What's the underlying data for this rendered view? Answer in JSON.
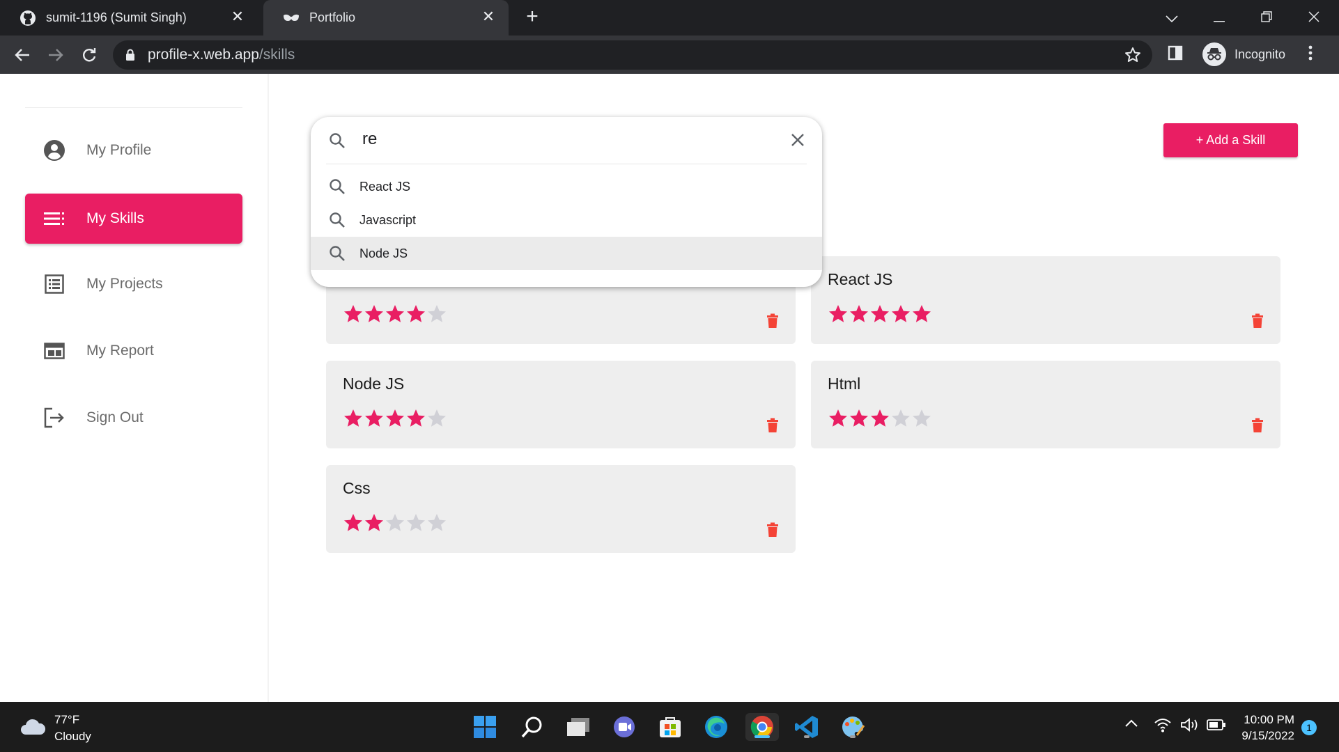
{
  "browser": {
    "tabs": [
      {
        "title": "sumit-1196 (Sumit Singh)",
        "icon": "github-icon",
        "active": false
      },
      {
        "title": "Portfolio",
        "icon": "mask-icon",
        "active": true
      }
    ],
    "url_host": "profile-x.web.app",
    "url_path": "/skills",
    "profile_label": "Incognito",
    "close_glyph": "✕",
    "newtab_glyph": "+"
  },
  "sidebar": {
    "items": [
      {
        "label": "My Profile",
        "icon": "account-circle-icon",
        "active": false
      },
      {
        "label": "My Skills",
        "icon": "list-icon",
        "active": true
      },
      {
        "label": "My Projects",
        "icon": "project-list-icon",
        "active": false
      },
      {
        "label": "My Report",
        "icon": "report-icon",
        "active": false
      },
      {
        "label": "Sign Out",
        "icon": "sign-out-icon",
        "active": false
      }
    ]
  },
  "search": {
    "value": "re",
    "suggestions": [
      {
        "label": "React JS"
      },
      {
        "label": "Javascript"
      },
      {
        "label": "Node JS",
        "selected": true
      }
    ]
  },
  "add_button_label": "+ Add a Skill",
  "skills": [
    {
      "name": "",
      "rating": 4,
      "max": 5
    },
    {
      "name": "React JS",
      "rating": 5,
      "max": 5
    },
    {
      "name": "Node JS",
      "rating": 4,
      "max": 5
    },
    {
      "name": "Html",
      "rating": 3,
      "max": 5
    },
    {
      "name": "Css",
      "rating": 2,
      "max": 5
    }
  ],
  "colors": {
    "accent": "#e91e63",
    "star_filled": "#e91e63",
    "star_empty": "#d0d0d6",
    "trash": "#f44336"
  },
  "taskbar": {
    "weather_temp": "77°F",
    "weather_desc": "Cloudy",
    "apps": [
      "start-icon",
      "search-icon",
      "task-view-icon",
      "chat-icon",
      "store-icon",
      "edge-icon",
      "chrome-icon",
      "vscode-icon",
      "paint-icon"
    ],
    "time": "10:00 PM",
    "date": "9/15/2022",
    "notification_count": "1"
  }
}
